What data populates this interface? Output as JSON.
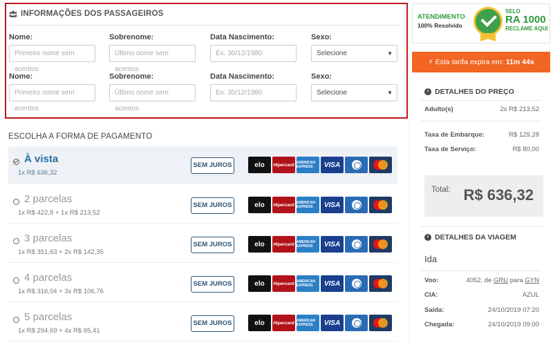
{
  "passengers": {
    "title": "INFORMAÇÕES DOS PASSAGEIROS",
    "rows": [
      {
        "nome_label": "Nome:",
        "nome_placeholder": "Primeiro nome sem acentos",
        "sobrenome_label": "Sobrenome:",
        "sobrenome_placeholder": "Último nome sem acentos",
        "nasc_label": "Data Nascimento:",
        "nasc_placeholder": "Ex. 30/12/1980",
        "sexo_label": "Sexo:",
        "sexo_value": "Selecione"
      },
      {
        "nome_label": "Nome:",
        "nome_placeholder": "Primeiro nome sem acentos",
        "sobrenome_label": "Sobrenome:",
        "sobrenome_placeholder": "Último nome sem acentos",
        "nasc_label": "Data Nascimento:",
        "nasc_placeholder": "Ex. 30/12/1980",
        "sexo_label": "Sexo:",
        "sexo_value": "Selecione"
      }
    ]
  },
  "payment": {
    "title": "ESCOLHA A FORMA DE PAGAMENTO",
    "button_label": "SEM JUROS",
    "options": [
      {
        "label": "À vista",
        "detail": "1x R$ 636,32",
        "selected": true
      },
      {
        "label": "2 parcelas",
        "detail": "1x R$ 422,8 + 1x R$ 213,52",
        "selected": false
      },
      {
        "label": "3 parcelas",
        "detail": "1x R$ 351,63 + 2x R$ 142,35",
        "selected": false
      },
      {
        "label": "4 parcelas",
        "detail": "1x R$ 316,04 + 3x R$ 106,76",
        "selected": false
      },
      {
        "label": "5 parcelas",
        "detail": "1x R$ 294,69 + 4x R$ 85,41",
        "selected": false
      }
    ],
    "cards": {
      "elo": "elo",
      "hipercard": "Hipercard",
      "amex": "AMERICAN EXPRESS",
      "visa": "VISA",
      "diners": "diners",
      "mastercard": "mastercard"
    }
  },
  "badge": {
    "left_line1": "ATENDIMENTO",
    "left_line2": "100% Resolvido",
    "right_line1": "SELO",
    "right_line2": "RA 1000",
    "right_line3": "RECLAME AQUI"
  },
  "expire": {
    "prefix": "Esta tarifa expira em:",
    "time": "11m 44s"
  },
  "price": {
    "title": "DETALHES DO PREÇO",
    "adult_label": "Adulto(s)",
    "adult_value": "2x R$ 213,52",
    "boarding_label": "Taxa de Embarque:",
    "boarding_value": "R$ 129,28",
    "service_label": "Taxa de Serviço:",
    "service_value": "R$ 80,00",
    "total_label": "Total:",
    "total_value": "R$ 636,32"
  },
  "trip": {
    "title": "DETALHES DA VIAGEM",
    "direction": "Ida",
    "voo_label": "Voo:",
    "voo_number": "4052, de",
    "voo_from": "GRU",
    "voo_para": "para",
    "voo_to": "GYN",
    "cia_label": "CIA:",
    "cia_value": "AZUL",
    "saida_label": "Saída:",
    "saida_value": "24/10/2019 07:20",
    "chegada_label": "Chegada:",
    "chegada_value": "24/10/2019 09:00"
  },
  "colors": {
    "accent_red": "#c0161e",
    "accent_orange": "#f26522",
    "link_blue": "#2b6c9e",
    "seal_green": "#2e9a3c"
  }
}
